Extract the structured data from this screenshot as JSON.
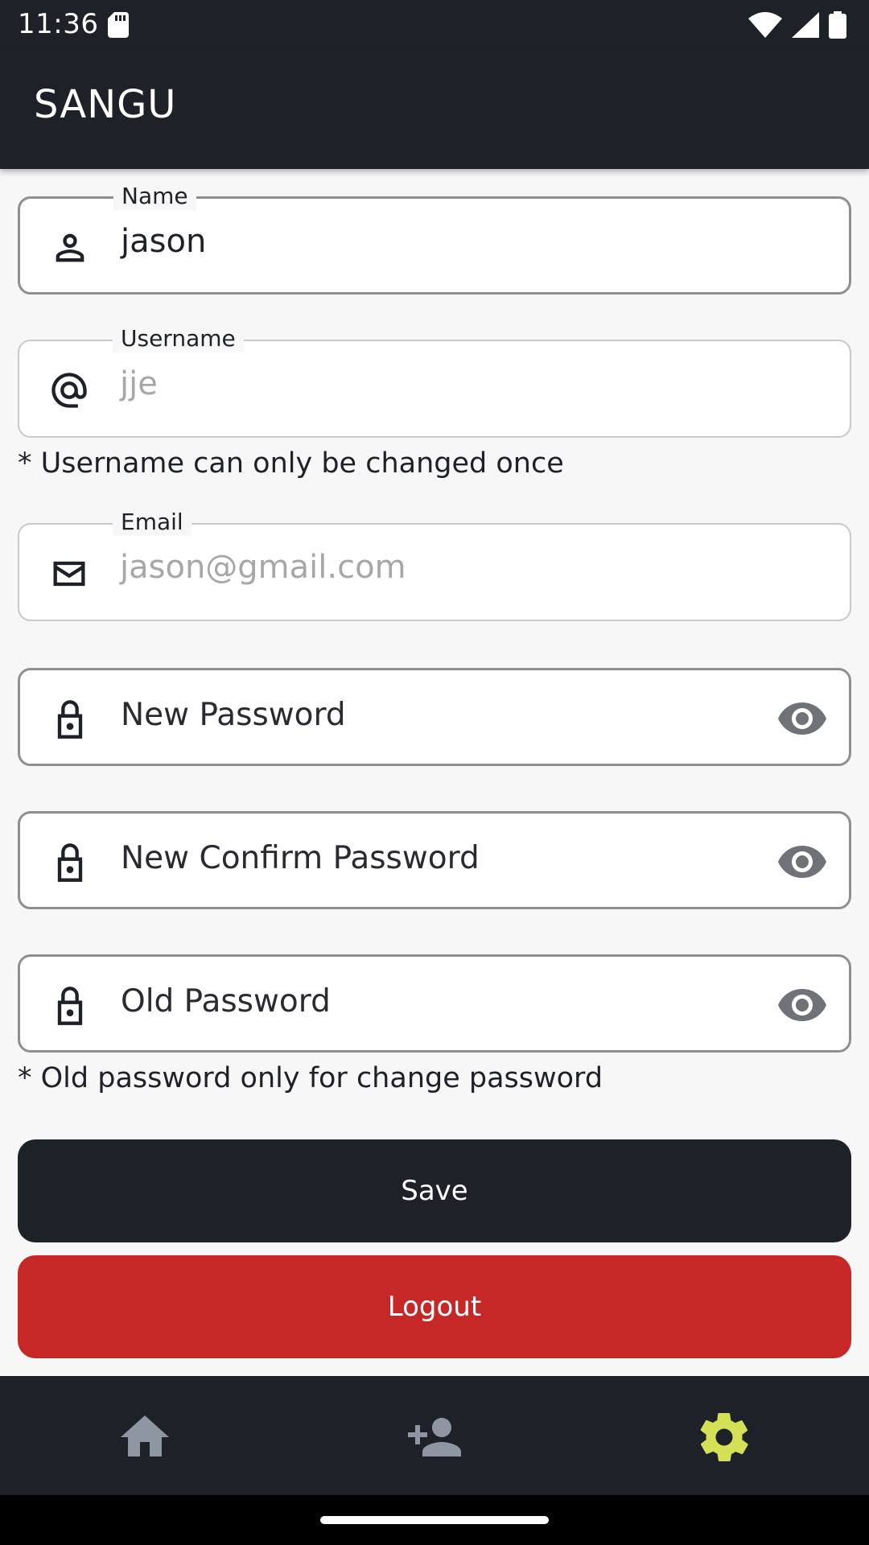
{
  "status_bar": {
    "time": "11:36"
  },
  "app_bar": {
    "title": "SANGU"
  },
  "form": {
    "name": {
      "label": "Name",
      "value": "jason"
    },
    "username": {
      "label": "Username",
      "value": "jje"
    },
    "username_note": "* Username can only be changed once",
    "email": {
      "label": "Email",
      "value": "jason@gmail.com"
    },
    "new_password": {
      "placeholder": "New Password"
    },
    "confirm_password": {
      "placeholder": "New Confirm Password"
    },
    "old_password": {
      "placeholder": "Old Password"
    },
    "old_password_note": "* Old password only for change password"
  },
  "buttons": {
    "save": "Save",
    "logout": "Logout"
  },
  "bottom_nav": {
    "items": [
      {
        "icon": "home-icon",
        "active": false
      },
      {
        "icon": "person-add-icon",
        "active": false
      },
      {
        "icon": "gear-icon",
        "active": true
      }
    ],
    "active_color": "#d4e157",
    "inactive_color": "#8e96a3"
  },
  "colors": {
    "primary": "#1f2128",
    "danger": "#c62828"
  }
}
